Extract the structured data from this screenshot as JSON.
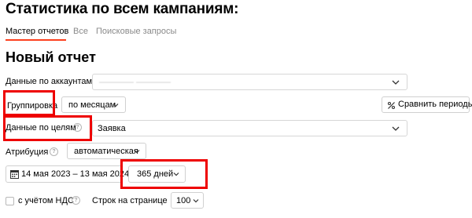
{
  "page": {
    "title": "Статистика по всем кампаниям:"
  },
  "tabs": [
    {
      "label": "Мастер отчетов",
      "active": true
    },
    {
      "label": "Все",
      "active": false
    },
    {
      "label": "Поисковые запросы",
      "active": false
    }
  ],
  "report": {
    "title": "Новый отчет",
    "accounts": {
      "label": "Данные по аккаунтам",
      "value_blurred": "———— ————"
    },
    "grouping": {
      "label": "Группировка",
      "value": "по месяцам"
    },
    "compare": {
      "label": "Сравнить периоды",
      "icon": "percent-compare-icon"
    },
    "goals": {
      "label": "Данные по целям",
      "value": "Заявка"
    },
    "attribution": {
      "label": "Атрибуция",
      "value": "автоматическая"
    },
    "period": {
      "range": "14 мая 2023 – 13 мая 2024",
      "preset": "365 дней",
      "icon": "calendar-icon"
    },
    "vat": {
      "label": "с учётом НДС",
      "checked": false
    },
    "rows_per_page": {
      "label": "Строк на странице",
      "value": "100"
    }
  },
  "annotations": {
    "highlight_color": "#ee0000"
  },
  "colors": {
    "accent": "#fc3f1d",
    "muted_text": "#8a8a8a",
    "border": "#d6d6d6"
  }
}
